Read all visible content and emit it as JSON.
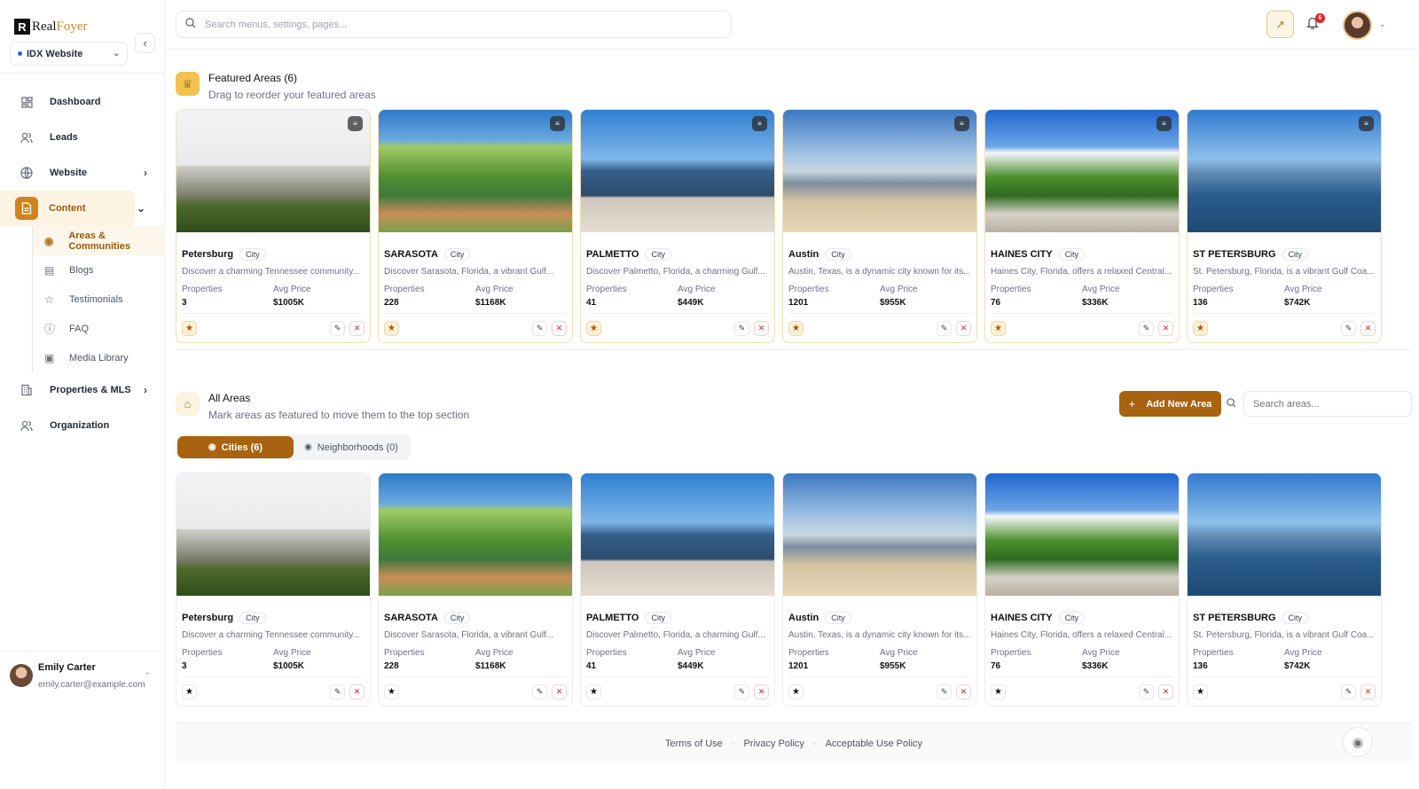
{
  "brand": {
    "mark": "R",
    "name_main": "Real",
    "name_accent": "Foyer"
  },
  "site_selector": {
    "value": "IDX Website"
  },
  "sidebar": {
    "items": [
      {
        "label": "Dashboard",
        "icon": "grid-icon"
      },
      {
        "label": "Leads",
        "icon": "users-icon"
      },
      {
        "label": "Website",
        "icon": "globe-icon"
      },
      {
        "label": "Content",
        "icon": "document-icon"
      }
    ],
    "content_sub": [
      {
        "label": "Areas & Communities",
        "icon": "map-pin-icon"
      },
      {
        "label": "Blogs",
        "icon": "book-icon"
      },
      {
        "label": "Testimonials",
        "icon": "star-icon"
      },
      {
        "label": "FAQ",
        "icon": "help-circle-icon"
      },
      {
        "label": "Media Library",
        "icon": "image-icon"
      }
    ],
    "lower_items": [
      {
        "label": "Properties & MLS",
        "icon": "building-icon"
      },
      {
        "label": "Organization",
        "icon": "users-icon"
      }
    ]
  },
  "user": {
    "name": "Emily Carter",
    "email": "emily.carter@example.com"
  },
  "topbar": {
    "search_placeholder": "Search menus, settings, pages...",
    "notification_count": "6"
  },
  "featured": {
    "title": "Featured Areas (6)",
    "subtitle": "Drag to reorder your featured areas"
  },
  "all_areas": {
    "title": "All Areas",
    "subtitle": "Mark areas as featured to move them to the top section",
    "add_label": "Add New Area",
    "search_placeholder": "Search areas...",
    "tabs": [
      {
        "label": "Cities (6)"
      },
      {
        "label": "Neighborhoods (0)"
      }
    ]
  },
  "labels": {
    "properties": "Properties",
    "avg_price": "Avg Price"
  },
  "areas": [
    {
      "name": "Petersburg",
      "type": "City",
      "desc": "Discover a charming Tennessee community...",
      "properties": "3",
      "avg_price": "$1005K"
    },
    {
      "name": "SARASOTA",
      "type": "City",
      "desc": "Discover Sarasota, Florida, a vibrant Gulf...",
      "properties": "228",
      "avg_price": "$1168K"
    },
    {
      "name": "PALMETTO",
      "type": "City",
      "desc": "Discover Palmetto, Florida, a charming Gulf...",
      "properties": "41",
      "avg_price": "$449K"
    },
    {
      "name": "Austin",
      "type": "City",
      "desc": "Austin, Texas, is a dynamic city known for its...",
      "properties": "1201",
      "avg_price": "$955K"
    },
    {
      "name": "HAINES CITY",
      "type": "City",
      "desc": "Haines City, Florida, offers a relaxed Central...",
      "properties": "76",
      "avg_price": "$336K"
    },
    {
      "name": "ST PETERSBURG",
      "type": "City",
      "desc": "St. Petersburg, Florida, is a vibrant Gulf Coa...",
      "properties": "136",
      "avg_price": "$742K"
    }
  ],
  "footer": {
    "links": [
      "Terms of Use",
      "Privacy Policy",
      "Acceptable Use Policy"
    ]
  },
  "colors": {
    "accent": "#a7630f",
    "accent_light": "#fdf3e3",
    "danger": "#dc2626"
  }
}
